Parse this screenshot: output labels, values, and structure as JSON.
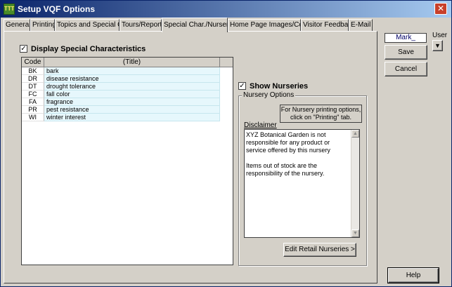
{
  "window": {
    "title": "Setup VQF Options",
    "icon_text": "TTT",
    "close_glyph": "✕"
  },
  "tabs": [
    {
      "label": "General"
    },
    {
      "label": "Printing"
    },
    {
      "label": "Topics and Special Coll."
    },
    {
      "label": "Tours/Reports"
    },
    {
      "label": "Special Char./Nurseries"
    },
    {
      "label": "Home Page Images/Colors"
    },
    {
      "label": "Visitor Feedback"
    },
    {
      "label": "E-Mail"
    }
  ],
  "active_tab": "Special Char./Nurseries",
  "special_chars": {
    "checkbox_label": "Display Special Characteristics",
    "checked": true,
    "check_glyph": "✓",
    "columns": [
      "Code",
      "(Title)"
    ],
    "rows": [
      {
        "code": "BK",
        "title": "bark"
      },
      {
        "code": "DR",
        "title": "disease resistance"
      },
      {
        "code": "DT",
        "title": "drought tolerance"
      },
      {
        "code": "FC",
        "title": "fall color"
      },
      {
        "code": "FA",
        "title": "fragrance"
      },
      {
        "code": "PR",
        "title": "pest resistance"
      },
      {
        "code": "WI",
        "title": "winter interest"
      }
    ]
  },
  "nurseries": {
    "checkbox_label": "Show Nurseries",
    "checked": true,
    "group_title": "Nursery Options",
    "info_line1": "For Nursery printing options,",
    "info_line2": "click on \"Printing\" tab.",
    "disclaimer_label": "Disclaimer",
    "disclaimer_p1": "XYZ Botanical Garden is not responsible for any product or service offered by this nursery",
    "disclaimer_p2": "Items out of stock are the responsibility of the nursery.",
    "edit_button": "Edit Retail Nurseries >"
  },
  "side": {
    "user_value": "Mark_",
    "user_label": "User",
    "user_dropdown_glyph": "▼",
    "save_label": "Save",
    "cancel_label": "Cancel",
    "help_label": "Help"
  },
  "colors": {
    "title_gradient_start": "#0a246a",
    "title_gradient_end": "#a6caf0",
    "row_highlight": "#e6f7fc",
    "close_button": "#c8402a"
  }
}
